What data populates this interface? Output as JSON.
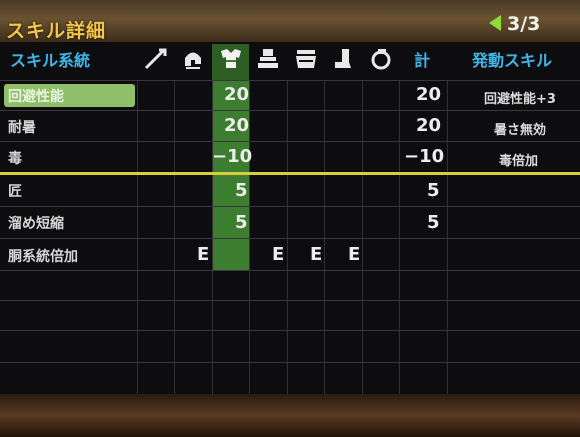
{
  "title": "スキル詳細",
  "page": "3/3",
  "header": {
    "col_skill": "スキル系統",
    "col_total": "計",
    "col_active": "発動スキル"
  },
  "equip_icons": [
    "weapon-icon",
    "helm-icon",
    "chest-icon",
    "arms-icon",
    "waist-icon",
    "legs-icon",
    "charm-icon"
  ],
  "rows": [
    {
      "name": "回避性能",
      "chest": "20",
      "total": "20",
      "effect": "回避性能+3"
    },
    {
      "name": "耐暑",
      "chest": "20",
      "total": "20",
      "effect": "暑さ無効"
    },
    {
      "name": "毒",
      "chest": "−10",
      "total": "−10",
      "effect": "毒倍加"
    },
    {
      "name": "匠",
      "chest": "5",
      "total": "5",
      "effect": ""
    },
    {
      "name": "溜め短縮",
      "chest": "5",
      "total": "5",
      "effect": ""
    },
    {
      "name": "胴系統倍加",
      "helm": "E",
      "arms": "E",
      "waist": "E",
      "legs": "E"
    }
  ],
  "colors": {
    "accent": "#3fb6e8",
    "title": "#f0c74a",
    "highlight": "#3d7d2f",
    "separator": "#d8cf3a"
  }
}
